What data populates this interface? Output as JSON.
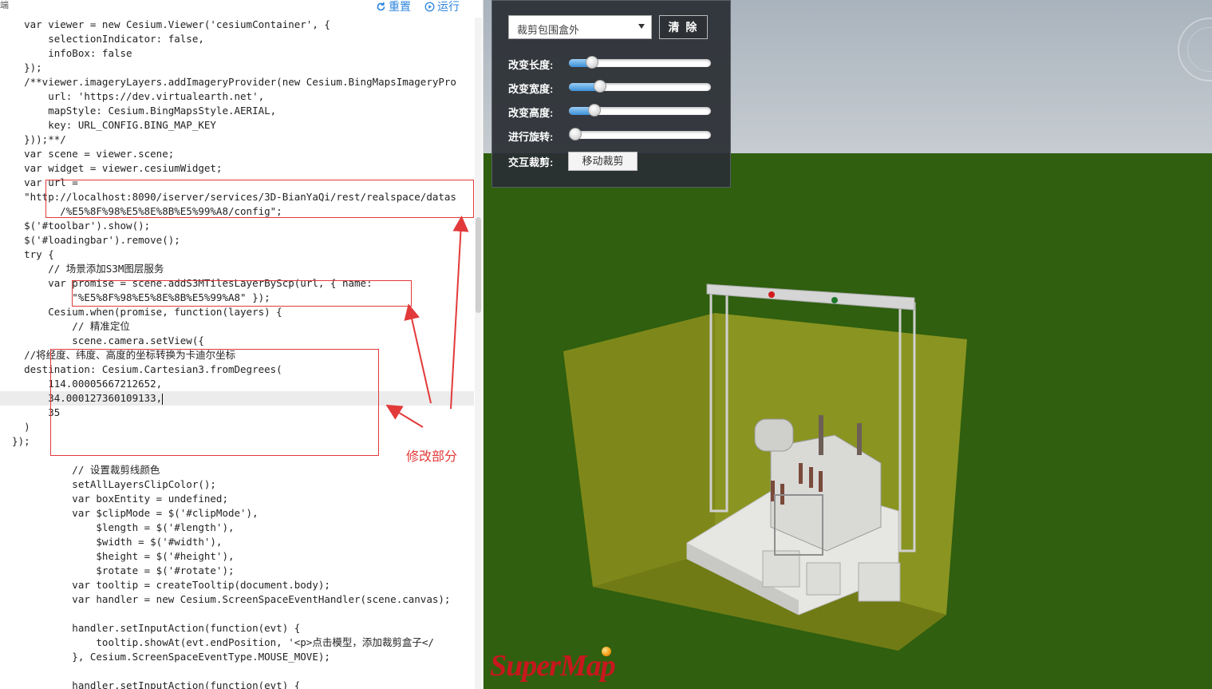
{
  "editor": {
    "cut_label": "端",
    "reset_label": "重置",
    "run_label": "运行",
    "lines": [
      "    var viewer = new Cesium.Viewer('cesiumContainer', {",
      "        selectionIndicator: false,",
      "        infoBox: false",
      "    });",
      "    /**viewer.imageryLayers.addImageryProvider(new Cesium.BingMapsImageryPro",
      "        url: 'https://dev.virtualearth.net',",
      "        mapStyle: Cesium.BingMapsStyle.AERIAL,",
      "        key: URL_CONFIG.BING_MAP_KEY",
      "    }));**/",
      "    var scene = viewer.scene;",
      "    var widget = viewer.cesiumWidget;",
      "    var url =",
      "    \"http://localhost:8090/iserver/services/3D-BianYaQi/rest/realspace/datas",
      "          /%E5%8F%98%E5%8E%8B%E5%99%A8/config\";",
      "    $('#toolbar').show();",
      "    $('#loadingbar').remove();",
      "    try {",
      "        // 场景添加S3M图层服务",
      "        var promise = scene.addS3MTilesLayerByScp(url, { name:",
      "            \"%E5%8F%98%E5%8E%8B%E5%99%A8\" });",
      "        Cesium.when(promise, function(layers) {",
      "            // 精准定位",
      "            scene.camera.setView({",
      "    //将经度、纬度、高度的坐标转换为卡迪尔坐标",
      "    destination: Cesium.Cartesian3.fromDegrees(",
      "        114.00005667212652,",
      "        34.000127360109133,",
      "        35",
      "    )",
      "  });",
      "",
      "            // 设置裁剪线颜色",
      "            setAllLayersClipColor();",
      "            var boxEntity = undefined;",
      "            var $clipMode = $('#clipMode'),",
      "                $length = $('#length'),",
      "                $width = $('#width'),",
      "                $height = $('#height'),",
      "                $rotate = $('#rotate');",
      "            var tooltip = createTooltip(document.body);",
      "            var handler = new Cesium.ScreenSpaceEventHandler(scene.canvas);",
      "",
      "            handler.setInputAction(function(evt) {",
      "                tooltip.showAt(evt.endPosition, '<p>点击模型，添加裁剪盒子</",
      "            }, Cesium.ScreenSpaceEventType.MOUSE_MOVE);",
      "",
      "            handler.setInputAction(function(evt) {"
    ],
    "active_line_index": 26,
    "annotation_label": "修改部分"
  },
  "panel": {
    "clip_mode_value": "裁剪包围盒外",
    "clear_label": "清 除",
    "sliders": [
      {
        "label": "改变长度:",
        "value": 0.13
      },
      {
        "label": "改变宽度:",
        "value": 0.19
      },
      {
        "label": "改变高度:",
        "value": 0.15
      },
      {
        "label": "进行旋转:",
        "value": 0.0
      }
    ],
    "interactive_label": "交互裁剪:",
    "move_clip_label": "移动裁剪"
  },
  "logo_text": "SuperMap",
  "colors": {
    "sky": "#b6bfc7",
    "ground": "#2f5f0f",
    "clip_box": "#8c8f1c",
    "annotation": "#e23a3a",
    "link": "#2e86de"
  }
}
